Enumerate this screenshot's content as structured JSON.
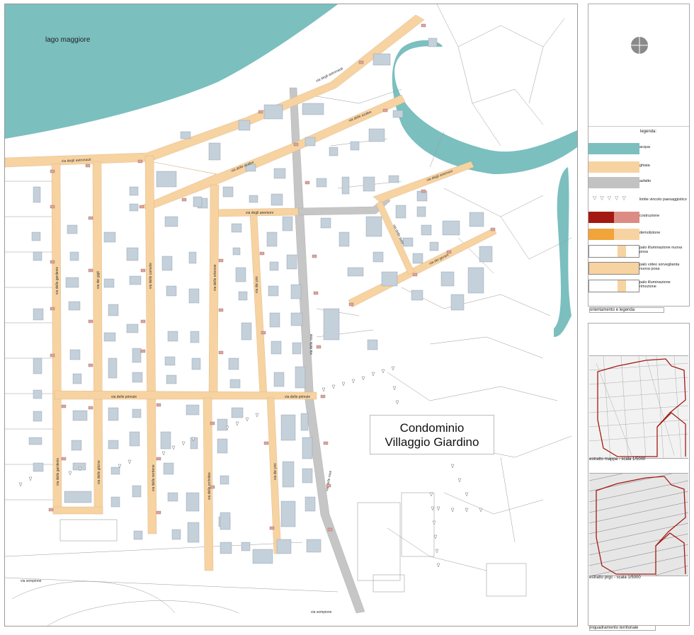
{
  "map": {
    "lake_label": "lago maggiore",
    "title_line1": "Condominio",
    "title_line2": "Villaggio Giardino",
    "streets": {
      "astronauti": "via degli astronauti",
      "astronauti2": "via degli astronauti",
      "azalee": "via delle azalee",
      "azalee2": "via delle azalee",
      "anemoni": "via degli anemoni",
      "anemoni2": "via degli anemoni",
      "gardenie": "via delle gardenie",
      "gigli": "via dei gigli",
      "camelie": "via delle camelie",
      "ortensie": "via delle ortensie",
      "pini": "via dei pini",
      "rose": "via delle rose",
      "rose2": "via delle rose",
      "primule": "via delle primule",
      "primule2": "via delle primule",
      "glicine": "via delle glicine",
      "verbene": "via delle verbene",
      "orchidee": "via delle orchidee",
      "pini2": "via dei pini",
      "gerani": "via dei gerani",
      "dalie": "via delle dalie",
      "sempione": "via sempione",
      "sempione2": "via sempione"
    }
  },
  "legend": {
    "title": "legenda:",
    "items": [
      {
        "label": "acqua",
        "color": "#7bbfbf"
      },
      {
        "label": "ghiaia",
        "color": "#f7d3a1"
      },
      {
        "label": "asfalto",
        "color": "#c2c2c2"
      },
      {
        "label": "limite vincolo paesaggistico",
        "color": "#888888"
      },
      {
        "label": "costruzione",
        "color": "#a31a12",
        "color2": "#dc8c84"
      },
      {
        "label": "demolizione",
        "color": "#f0a43a",
        "color2": "#f7d3a1"
      },
      {
        "label": "palo illuminazione nuova posa",
        "color": "#f7d3a1"
      },
      {
        "label": "palo video sorveglianta nuova posa",
        "color": "#f7d3a1"
      },
      {
        "label": "palo illuminazione rimozione",
        "color": "#f7d3a1"
      }
    ],
    "footer": "orientamento e legenda"
  },
  "context": {
    "caption_map": "estratto mappa - scala 1/5000",
    "caption_prgc": "estratto prgc - scala 1/5000",
    "footer": "inquadramento territoriale"
  }
}
